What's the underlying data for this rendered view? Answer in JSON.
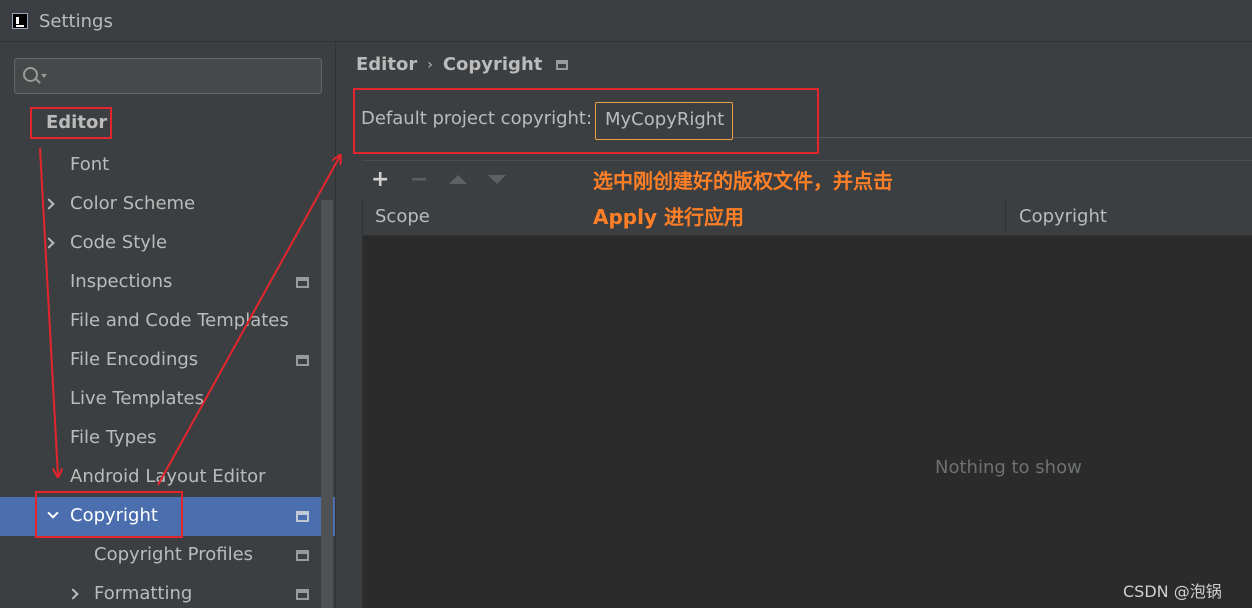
{
  "window": {
    "title": "Settings"
  },
  "search": {
    "placeholder": ""
  },
  "sidebar": {
    "root": "Editor",
    "items": [
      {
        "label": "Font",
        "expander": "none",
        "badge": false,
        "depth": 1
      },
      {
        "label": "Color Scheme",
        "expander": "collapsed",
        "badge": false,
        "depth": 1
      },
      {
        "label": "Code Style",
        "expander": "collapsed",
        "badge": false,
        "depth": 1
      },
      {
        "label": "Inspections",
        "expander": "none",
        "badge": true,
        "depth": 1
      },
      {
        "label": "File and Code Templates",
        "expander": "none",
        "badge": false,
        "depth": 1
      },
      {
        "label": "File Encodings",
        "expander": "none",
        "badge": true,
        "depth": 1
      },
      {
        "label": "Live Templates",
        "expander": "none",
        "badge": false,
        "depth": 1
      },
      {
        "label": "File Types",
        "expander": "none",
        "badge": false,
        "depth": 1
      },
      {
        "label": "Android Layout Editor",
        "expander": "none",
        "badge": false,
        "depth": 1
      },
      {
        "label": "Copyright",
        "expander": "expanded",
        "badge": true,
        "depth": 1,
        "selected": true
      },
      {
        "label": "Copyright Profiles",
        "expander": "none",
        "badge": true,
        "depth": 2
      },
      {
        "label": "Formatting",
        "expander": "collapsed",
        "badge": true,
        "depth": 2
      }
    ]
  },
  "breadcrumb": {
    "parent": "Editor",
    "separator": "›",
    "current": "Copyright"
  },
  "default_copyright": {
    "label": "Default project copyright:",
    "value": "MyCopyRight"
  },
  "toolbar": {
    "add": "+",
    "remove": "−"
  },
  "table": {
    "columns": [
      "Scope",
      "Copyright"
    ],
    "empty_text": "Nothing to show"
  },
  "annotation": {
    "line1": "选中刚创建好的版权文件，并点击",
    "line2": "Apply 进行应用"
  },
  "watermark": "CSDN @泡锅",
  "colors": {
    "selection": "#4b6eaf",
    "annotation_red": "#e3262d",
    "annotation_orange": "#ff7f27",
    "focus_border": "#e5a04a"
  }
}
